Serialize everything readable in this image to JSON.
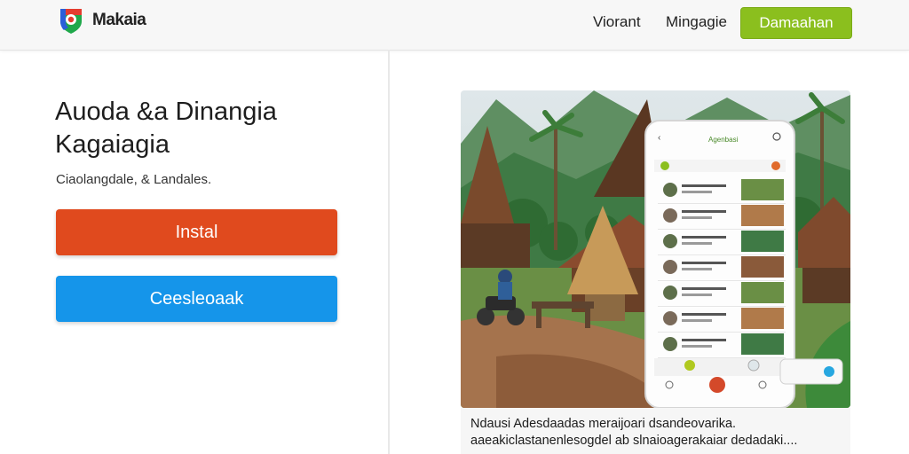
{
  "header": {
    "brand": "Makaia",
    "nav": [
      "Viorant",
      "Mingagie"
    ],
    "cta_label": "Damaahan"
  },
  "hero": {
    "headline": "Auoda &a Dinangia Kagaiagia",
    "subline": "Ciaolangdale, & Landales.",
    "install_label": "Instal",
    "secondary_label": "Ceesleoaak"
  },
  "phone": {
    "header_title": "Agenbasi",
    "rows": 7
  },
  "caption": {
    "line1": "Ndausi Adesdaadas meraijoari dsandeovarika.",
    "line2": "aaeakiclastanenlesogdel ab slnaioagerakaiar dedadaki...."
  },
  "colors": {
    "cta": "#8bbf1e",
    "install": "#e04a1e",
    "secondary": "#1595ea"
  }
}
